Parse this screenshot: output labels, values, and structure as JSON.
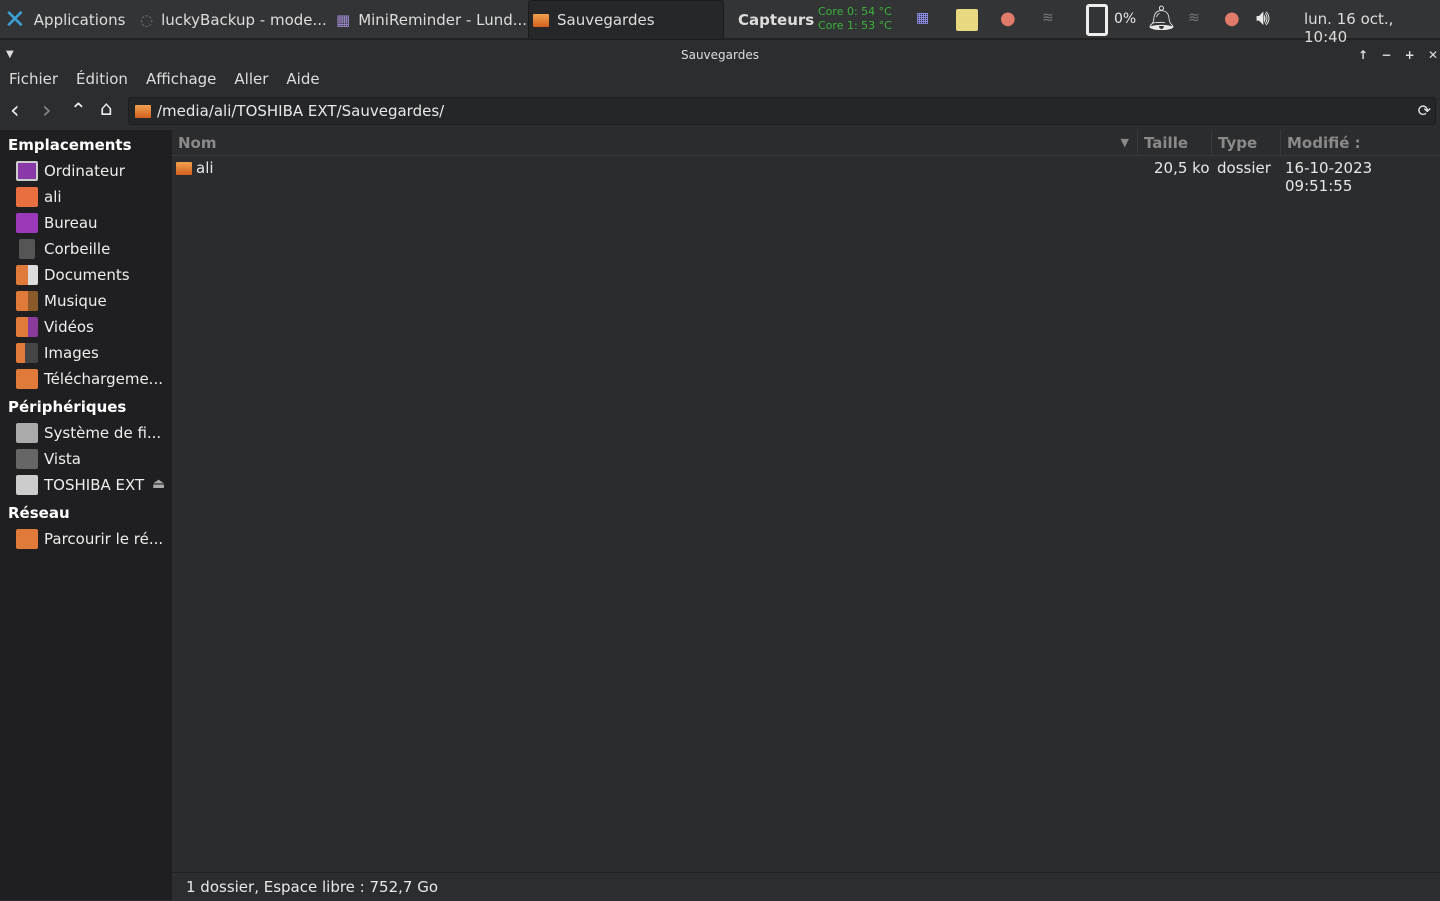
{
  "panel": {
    "apps_label": "Applications",
    "tasks": [
      "luckyBackup - mode...",
      "MiniReminder - Lund...",
      "Sauvegardes"
    ],
    "sensors_label": "Capteurs",
    "core0": "Core 0: 54 °C",
    "core1": "Core 1: 53 °C",
    "battery": "0%",
    "clock": "lun. 16 oct., 10:40"
  },
  "window": {
    "title": "Sauvegardes",
    "controls": [
      "↑",
      "−",
      "+",
      "✕"
    ]
  },
  "menu": [
    "Fichier",
    "Édition",
    "Affichage",
    "Aller",
    "Aide"
  ],
  "path": "/media/ali/TOSHIBA EXT/Sauvegardes/",
  "sidebar": {
    "sections": [
      {
        "title": "Emplacements",
        "items": [
          "Ordinateur",
          "ali",
          "Bureau",
          "Corbeille",
          "Documents",
          "Musique",
          "Vidéos",
          "Images",
          "Téléchargeme..."
        ]
      },
      {
        "title": "Périphériques",
        "items": [
          "Système de fi...",
          "Vista",
          "TOSHIBA EXT"
        ]
      },
      {
        "title": "Réseau",
        "items": [
          "Parcourir le ré..."
        ]
      }
    ]
  },
  "columns": [
    "Nom",
    "Taille",
    "Type",
    "Modifié :"
  ],
  "rows": [
    {
      "name": "ali",
      "size": "20,5 ko",
      "type": "dossier",
      "modified": "16-10-2023 09:51:55"
    }
  ],
  "status": "1 dossier, Espace libre : 752,7 Go"
}
